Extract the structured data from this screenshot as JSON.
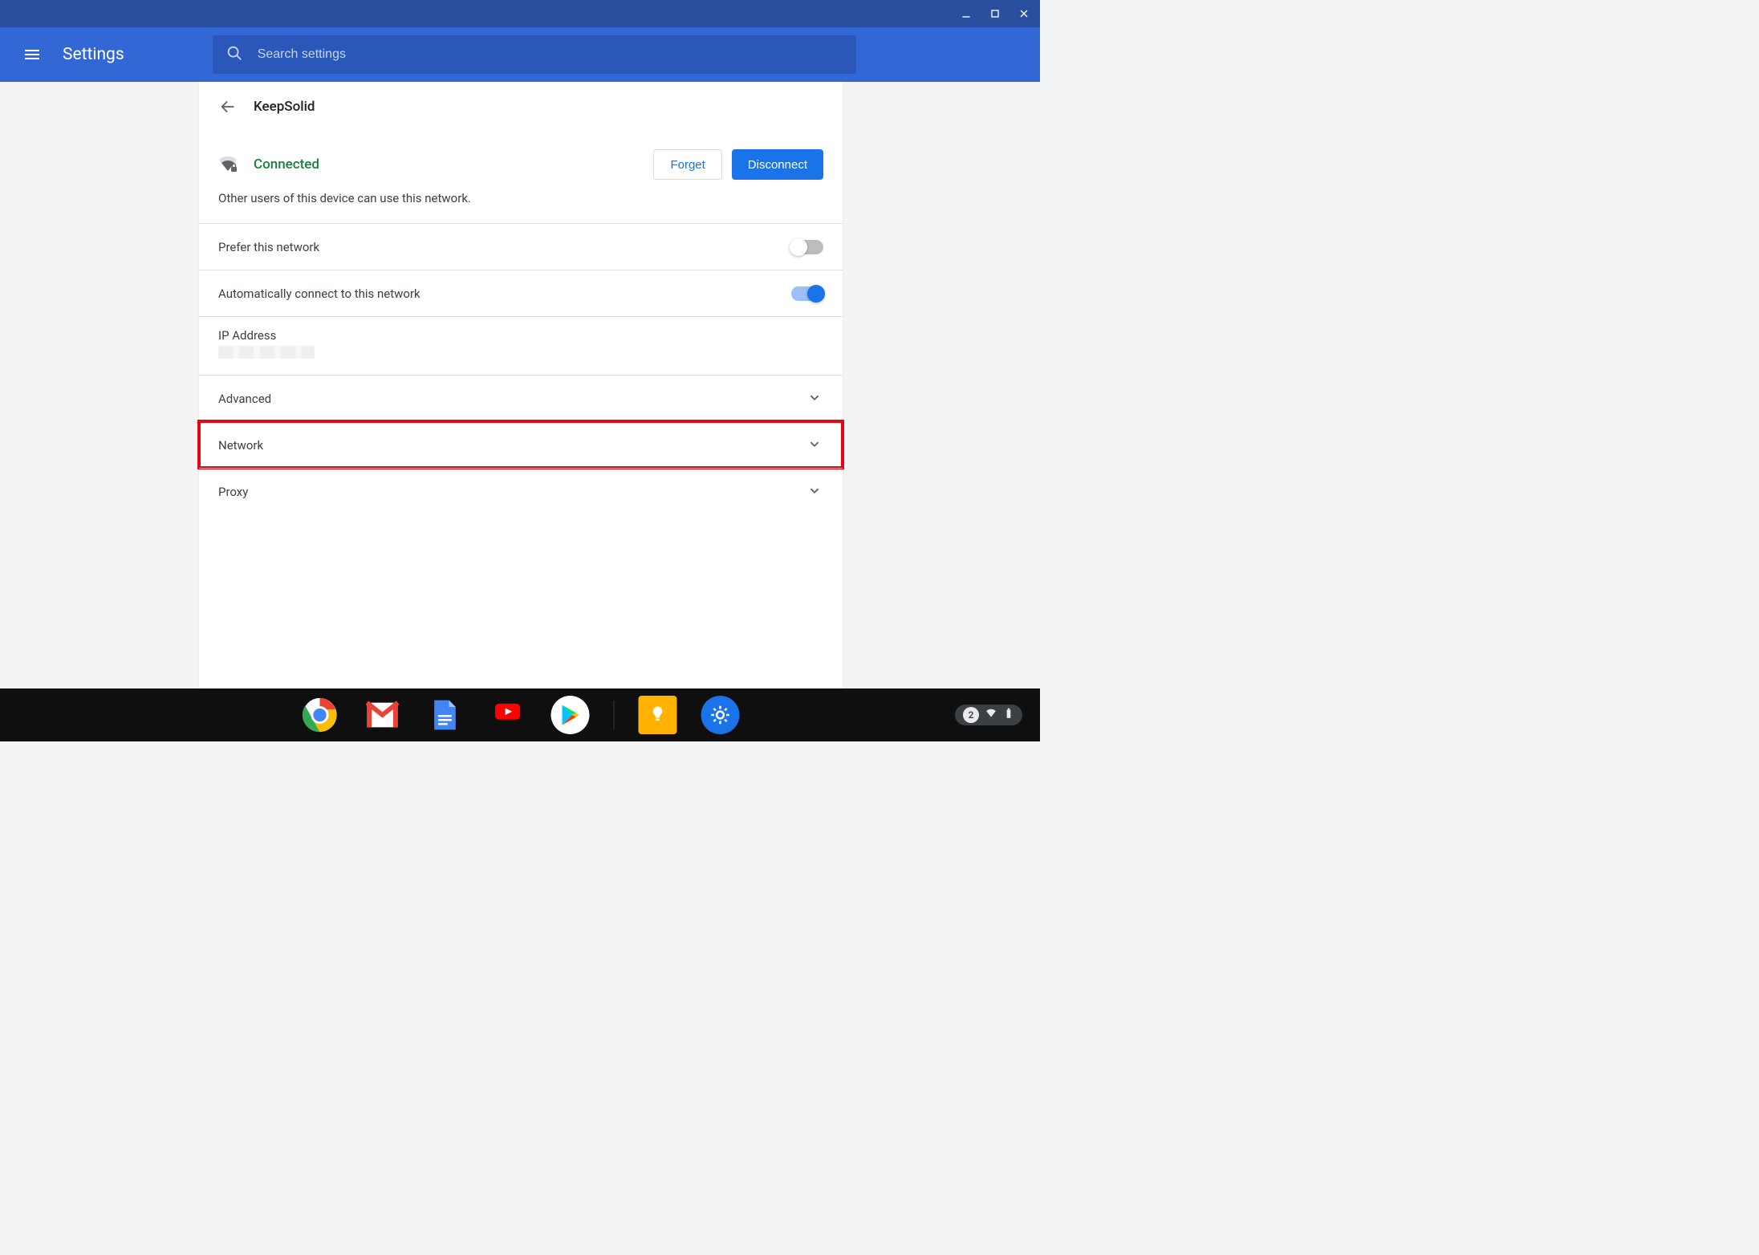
{
  "titlebar": {},
  "toolbar": {
    "app_title": "Settings",
    "search_placeholder": "Search settings"
  },
  "subpage": {
    "title": "KeepSolid",
    "status": "Connected",
    "forget_label": "Forget",
    "disconnect_label": "Disconnect",
    "share_note": "Other users of this device can use this network."
  },
  "rows": {
    "prefer": {
      "label": "Prefer this network",
      "on": false
    },
    "autoconnect": {
      "label": "Automatically connect to this network",
      "on": true
    },
    "ip_label": "IP Address",
    "advanced": "Advanced",
    "network": "Network",
    "proxy": "Proxy"
  },
  "shelf": {
    "notification_count": "2"
  }
}
